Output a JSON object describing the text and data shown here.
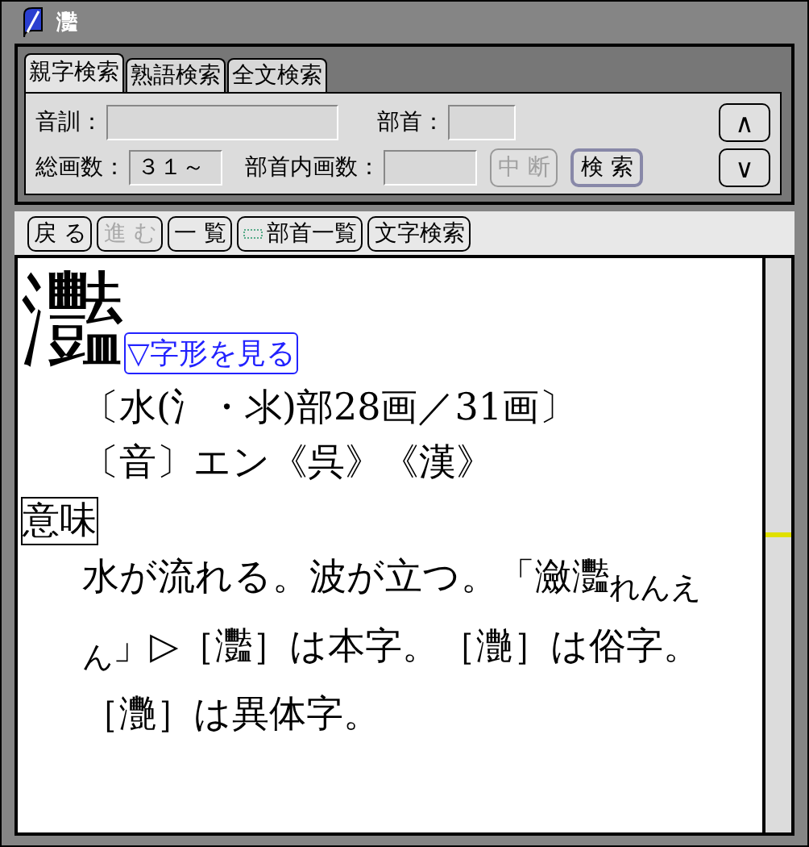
{
  "window": {
    "title": "灩"
  },
  "tabs": [
    {
      "label": "親字検索",
      "selected": true
    },
    {
      "label": "熟語検索",
      "selected": false
    },
    {
      "label": "全文検索",
      "selected": false
    }
  ],
  "search_form": {
    "reading": {
      "label": "音訓："
    },
    "radical": {
      "label": "部首："
    },
    "total_strokes": {
      "label": "総画数：",
      "value": "３１～"
    },
    "radical_strokes": {
      "label": "部首内画数："
    },
    "stop_button": {
      "label": "中 断",
      "disabled": true
    },
    "search_button": {
      "label": "検 索",
      "disabled": false
    },
    "up_button": {
      "label": "∧"
    },
    "down_button": {
      "label": "∨"
    }
  },
  "toolbar": [
    {
      "label": "戻 る",
      "disabled": false,
      "kind": "text"
    },
    {
      "label": "進 む",
      "disabled": true,
      "kind": "text"
    },
    {
      "label": "一 覧",
      "disabled": false,
      "kind": "text"
    },
    {
      "label": "部首一覧",
      "disabled": false,
      "kind": "icon"
    },
    {
      "label": "文字検索",
      "disabled": false,
      "kind": "text"
    }
  ],
  "entry": {
    "headword": "灩",
    "shape_link": "▽字形を見る",
    "radical_info": "〔水(氵・氺)部28画／31画〕",
    "reading_info": "〔音〕エン《呉》《漢》",
    "meaning_label": "意味",
    "meaning": "水が流れる。波が立つ。「瀲灩$_{れんえん}$」▷［灩］は本字。［灔］は俗字。［灧］は異体字。"
  }
}
